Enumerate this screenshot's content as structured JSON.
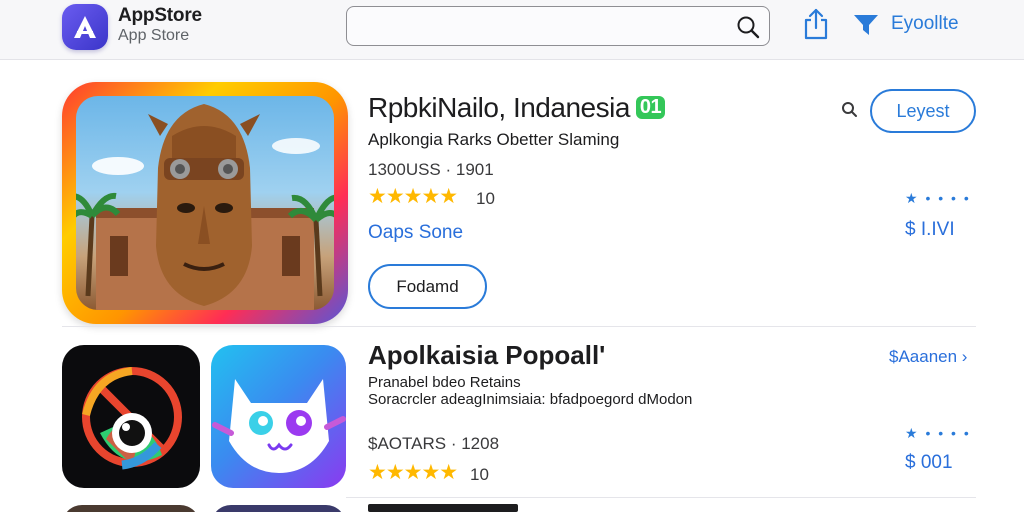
{
  "header": {
    "brand_title": "AppStore",
    "brand_sub": "App Store",
    "search_placeholder": "",
    "link_label": "Eyoollte",
    "accent": "#2a7bd9"
  },
  "featured": {
    "title": "RpbkiNailo, Indanesia",
    "badge": "01",
    "subtitle": "Aplkongia Rarks Obetter Slaming",
    "meta": "1300USS · 1901",
    "stars": "★★★★★",
    "rating": "10",
    "developer": "Oaps Sone",
    "action_label": "Fodamd",
    "right_button": "Leyest",
    "dots": "★ • • • •",
    "price": "$ I.IVI"
  },
  "popular": {
    "title": "Apolkaisia Popoall'",
    "see_all": "$Aaanen ›",
    "desc_line1": "Pranabel bdeo Retains",
    "desc_line2": "Soracrcler adeagInimsiaia: bfadpoegord dModon",
    "meta": "$AOTARS · 1208",
    "stars": "★★★★★",
    "rating": "10",
    "dots": "★ • • • •",
    "price": "$ 001"
  },
  "icons": {
    "logo": "app-store-logo-icon",
    "search": "search-icon",
    "share": "share-icon",
    "filter": "filter-icon"
  },
  "colors": {
    "accent_blue": "#2a7bd9",
    "star_gold": "#ffb800",
    "badge_green": "#34c759"
  }
}
